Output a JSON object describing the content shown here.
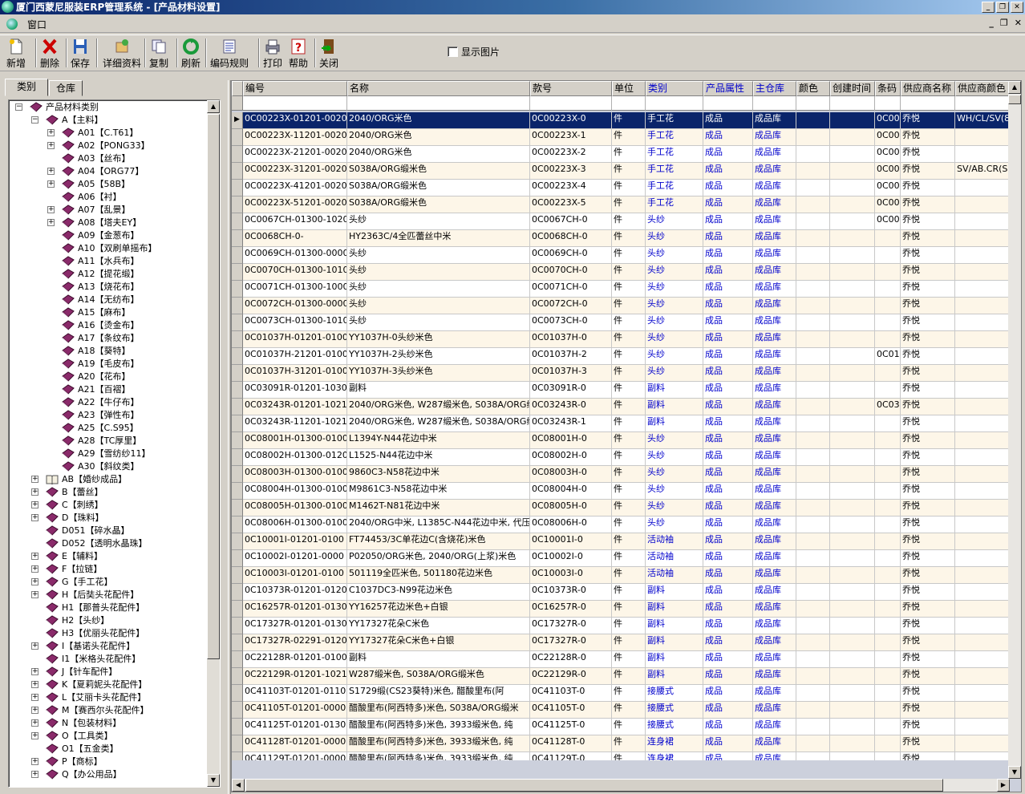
{
  "window": {
    "title": "厦门西蒙尼服装ERP管理系统 - [产品材料设置]"
  },
  "menu": {
    "window_label": "窗口"
  },
  "toolbar": {
    "buttons": [
      {
        "label": "新增",
        "icon": "new-document-icon"
      },
      {
        "label": "删除",
        "icon": "delete-x-icon"
      },
      {
        "label": "保存",
        "icon": "save-disk-icon"
      },
      {
        "label": "详细资料",
        "icon": "details-icon"
      },
      {
        "label": "复制",
        "icon": "copy-icon"
      },
      {
        "label": "刷新",
        "icon": "refresh-icon"
      },
      {
        "label": "编码规则",
        "icon": "code-rule-icon"
      },
      {
        "label": "打印",
        "icon": "print-icon"
      },
      {
        "label": "帮助",
        "icon": "help-icon"
      },
      {
        "label": "关闭",
        "icon": "close-door-icon"
      }
    ],
    "show_picture_label": "显示图片",
    "show_picture_checked": false
  },
  "left_tabs": [
    "类别",
    "仓库"
  ],
  "tree": [
    {
      "level": 0,
      "expander": "-",
      "label": "产品材料类别"
    },
    {
      "level": 1,
      "expander": "-",
      "label": "A【主料】"
    },
    {
      "level": 2,
      "expander": "+",
      "label": "A01【C.T61】"
    },
    {
      "level": 2,
      "expander": "+",
      "label": "A02【PONG33】"
    },
    {
      "level": 2,
      "expander": "",
      "label": "A03【丝布】"
    },
    {
      "level": 2,
      "expander": "+",
      "label": "A04【ORG77】"
    },
    {
      "level": 2,
      "expander": "+",
      "label": "A05【58B】"
    },
    {
      "level": 2,
      "expander": "",
      "label": "A06【衬】"
    },
    {
      "level": 2,
      "expander": "+",
      "label": "A07【乱景】"
    },
    {
      "level": 2,
      "expander": "+",
      "label": "A08【塔夫EY】"
    },
    {
      "level": 2,
      "expander": "",
      "label": "A09【金葱布】"
    },
    {
      "level": 2,
      "expander": "",
      "label": "A10【双刷单摇布】"
    },
    {
      "level": 2,
      "expander": "",
      "label": "A11【水兵布】"
    },
    {
      "level": 2,
      "expander": "",
      "label": "A12【提花缎】"
    },
    {
      "level": 2,
      "expander": "",
      "label": "A13【烧花布】"
    },
    {
      "level": 2,
      "expander": "",
      "label": "A14【无纺布】"
    },
    {
      "level": 2,
      "expander": "",
      "label": "A15【麻布】"
    },
    {
      "level": 2,
      "expander": "",
      "label": "A16【烫金布】"
    },
    {
      "level": 2,
      "expander": "",
      "label": "A17【条纹布】"
    },
    {
      "level": 2,
      "expander": "",
      "label": "A18【葵特】"
    },
    {
      "level": 2,
      "expander": "",
      "label": "A19【毛皮布】"
    },
    {
      "level": 2,
      "expander": "",
      "label": "A20【花布】"
    },
    {
      "level": 2,
      "expander": "",
      "label": "A21【百褶】"
    },
    {
      "level": 2,
      "expander": "",
      "label": "A22【牛仔布】"
    },
    {
      "level": 2,
      "expander": "",
      "label": "A23【弹性布】"
    },
    {
      "level": 2,
      "expander": "",
      "label": "A25【C.S95】"
    },
    {
      "level": 2,
      "expander": "",
      "label": "A28【TC厚里】"
    },
    {
      "level": 2,
      "expander": "",
      "label": "A29【雪纺纱11】"
    },
    {
      "level": 2,
      "expander": "",
      "label": "A30【斜纹类】"
    },
    {
      "level": 1,
      "expander": "+",
      "label": "AB【婚纱成品】",
      "book": "open"
    },
    {
      "level": 1,
      "expander": "+",
      "label": "B【蕾丝】"
    },
    {
      "level": 1,
      "expander": "+",
      "label": "C【刺绣】"
    },
    {
      "level": 1,
      "expander": "+",
      "label": "D【珠料】"
    },
    {
      "level": 1,
      "expander": "",
      "label": "D051【碎水晶】"
    },
    {
      "level": 1,
      "expander": "",
      "label": "D052【透明水晶珠】"
    },
    {
      "level": 1,
      "expander": "+",
      "label": "E【辅料】"
    },
    {
      "level": 1,
      "expander": "+",
      "label": "F【拉链】"
    },
    {
      "level": 1,
      "expander": "+",
      "label": "G【手工花】"
    },
    {
      "level": 1,
      "expander": "+",
      "label": "H【后奘头花配件】"
    },
    {
      "level": 1,
      "expander": "",
      "label": "H1【那普头花配件】"
    },
    {
      "level": 1,
      "expander": "",
      "label": "H2【头纱】"
    },
    {
      "level": 1,
      "expander": "",
      "label": "H3【优丽头花配件】"
    },
    {
      "level": 1,
      "expander": "+",
      "label": "I【基诺头花配件】"
    },
    {
      "level": 1,
      "expander": "",
      "label": "I1【米格头花配件】"
    },
    {
      "level": 1,
      "expander": "+",
      "label": "J【针车配件】"
    },
    {
      "level": 1,
      "expander": "+",
      "label": "K【夏莉妮头花配件】"
    },
    {
      "level": 1,
      "expander": "+",
      "label": "L【艾丽卡头花配件】"
    },
    {
      "level": 1,
      "expander": "+",
      "label": "M【赛西尔头花配件】"
    },
    {
      "level": 1,
      "expander": "+",
      "label": "N【包装材料】"
    },
    {
      "level": 1,
      "expander": "+",
      "label": "O【工具类】"
    },
    {
      "level": 1,
      "expander": "",
      "label": "O1【五金类】"
    },
    {
      "level": 1,
      "expander": "+",
      "label": "P【商标】"
    },
    {
      "level": 1,
      "expander": "+",
      "label": "Q【办公用品】"
    }
  ],
  "grid": {
    "columns": [
      {
        "label": "编号",
        "blue": false
      },
      {
        "label": "名称",
        "blue": false
      },
      {
        "label": "款号",
        "blue": false
      },
      {
        "label": "单位",
        "blue": false
      },
      {
        "label": "类别",
        "blue": true
      },
      {
        "label": "产品属性",
        "blue": true
      },
      {
        "label": "主仓库",
        "blue": true
      },
      {
        "label": "颜色",
        "blue": false
      },
      {
        "label": "创建时间",
        "blue": false
      },
      {
        "label": "条码",
        "blue": false
      },
      {
        "label": "供应商名称",
        "blue": false
      },
      {
        "label": "供应商颜色",
        "blue": false
      }
    ],
    "selected_row": 0,
    "rows": [
      [
        "0C00223X-01201-0020",
        "2040/ORG米色",
        "0C00223X-0",
        "件",
        "手工花",
        "成品",
        "成品库",
        "",
        "",
        "0C00",
        "乔悦",
        "WH/CL/SV(8"
      ],
      [
        "0C00223X-11201-0020",
        "2040/ORG米色",
        "0C00223X-1",
        "件",
        "手工花",
        "成品",
        "成品库",
        "",
        "",
        "0C00",
        "乔悦",
        ""
      ],
      [
        "0C00223X-21201-0020",
        "2040/ORG米色",
        "0C00223X-2",
        "件",
        "手工花",
        "成品",
        "成品库",
        "",
        "",
        "0C00",
        "乔悦",
        ""
      ],
      [
        "0C00223X-31201-0020",
        "S038A/ORG缎米色",
        "0C00223X-3",
        "件",
        "手工花",
        "成品",
        "成品库",
        "",
        "",
        "0C00",
        "乔悦",
        "SV/AB.CR(S"
      ],
      [
        "0C00223X-41201-0020",
        "S038A/ORG缎米色",
        "0C00223X-4",
        "件",
        "手工花",
        "成品",
        "成品库",
        "",
        "",
        "0C00",
        "乔悦",
        ""
      ],
      [
        "0C00223X-51201-0020",
        "S038A/ORG缎米色",
        "0C00223X-5",
        "件",
        "手工花",
        "成品",
        "成品库",
        "",
        "",
        "0C00",
        "乔悦",
        ""
      ],
      [
        "0C0067CH-01300-1020",
        "头纱",
        "0C0067CH-0",
        "件",
        "头纱",
        "成品",
        "成品库",
        "",
        "",
        "0C00",
        "乔悦",
        ""
      ],
      [
        "0C0068CH-0-",
        "HY2363C/4全匹蕾丝中米",
        "0C0068CH-0",
        "件",
        "头纱",
        "成品",
        "成品库",
        "",
        "",
        "",
        "乔悦",
        ""
      ],
      [
        "0C0069CH-01300-0000",
        "头纱",
        "0C0069CH-0",
        "件",
        "头纱",
        "成品",
        "成品库",
        "",
        "",
        "",
        "乔悦",
        ""
      ],
      [
        "0C0070CH-01300-1010",
        "头纱",
        "0C0070CH-0",
        "件",
        "头纱",
        "成品",
        "成品库",
        "",
        "",
        "",
        "乔悦",
        ""
      ],
      [
        "0C0071CH-01300-1000",
        "头纱",
        "0C0071CH-0",
        "件",
        "头纱",
        "成品",
        "成品库",
        "",
        "",
        "",
        "乔悦",
        ""
      ],
      [
        "0C0072CH-01300-0000",
        "头纱",
        "0C0072CH-0",
        "件",
        "头纱",
        "成品",
        "成品库",
        "",
        "",
        "",
        "乔悦",
        ""
      ],
      [
        "0C0073CH-01300-1010",
        "头纱",
        "0C0073CH-0",
        "件",
        "头纱",
        "成品",
        "成品库",
        "",
        "",
        "",
        "乔悦",
        ""
      ],
      [
        "0C01037H-01201-0100",
        "YY1037H-0头纱米色",
        "0C01037H-0",
        "件",
        "头纱",
        "成品",
        "成品库",
        "",
        "",
        "",
        "乔悦",
        ""
      ],
      [
        "0C01037H-21201-0100",
        "YY1037H-2头纱米色",
        "0C01037H-2",
        "件",
        "头纱",
        "成品",
        "成品库",
        "",
        "",
        "0C01",
        "乔悦",
        ""
      ],
      [
        "0C01037H-31201-0100",
        "YY1037H-3头纱米色",
        "0C01037H-3",
        "件",
        "头纱",
        "成品",
        "成品库",
        "",
        "",
        "",
        "乔悦",
        ""
      ],
      [
        "0C03091R-01201-1030",
        "副料",
        "0C03091R-0",
        "件",
        "副料",
        "成品",
        "成品库",
        "",
        "",
        "",
        "乔悦",
        ""
      ],
      [
        "0C03243R-01201-1021",
        "2040/ORG米色, W287缎米色, S038A/ORG缎",
        "0C03243R-0",
        "件",
        "副料",
        "成品",
        "成品库",
        "",
        "",
        "0C03",
        "乔悦",
        ""
      ],
      [
        "0C03243R-11201-1021",
        "2040/ORG米色, W287缎米色, S038A/ORG缎",
        "0C03243R-1",
        "件",
        "副料",
        "成品",
        "成品库",
        "",
        "",
        "",
        "乔悦",
        ""
      ],
      [
        "0C08001H-01300-0100",
        "L1394Y-N44花边中米",
        "0C08001H-0",
        "件",
        "头纱",
        "成品",
        "成品库",
        "",
        "",
        "",
        "乔悦",
        ""
      ],
      [
        "0C08002H-01300-0120",
        "L1525-N44花边中米",
        "0C08002H-0",
        "件",
        "头纱",
        "成品",
        "成品库",
        "",
        "",
        "",
        "乔悦",
        ""
      ],
      [
        "0C08003H-01300-0100",
        "9860C3-N58花边中米",
        "0C08003H-0",
        "件",
        "头纱",
        "成品",
        "成品库",
        "",
        "",
        "",
        "乔悦",
        ""
      ],
      [
        "0C08004H-01300-0100",
        "M9861C3-N58花边中米",
        "0C08004H-0",
        "件",
        "头纱",
        "成品",
        "成品库",
        "",
        "",
        "",
        "乔悦",
        ""
      ],
      [
        "0C08005H-01300-0100",
        "M1462T-N81花边中米",
        "0C08005H-0",
        "件",
        "头纱",
        "成品",
        "成品库",
        "",
        "",
        "",
        "乔悦",
        ""
      ],
      [
        "0C08006H-01300-0100",
        "2040/ORG中米, L1385C-N44花边中米, 代压",
        "0C08006H-0",
        "件",
        "头纱",
        "成品",
        "成品库",
        "",
        "",
        "",
        "乔悦",
        ""
      ],
      [
        "0C10001I-01201-0100",
        "FT74453/3C单花边C(含烧花)米色",
        "0C10001I-0",
        "件",
        "活动袖",
        "成品",
        "成品库",
        "",
        "",
        "",
        "乔悦",
        ""
      ],
      [
        "0C10002I-01201-0000",
        "P02050/ORG米色, 2040/ORG(上浆)米色",
        "0C10002I-0",
        "件",
        "活动袖",
        "成品",
        "成品库",
        "",
        "",
        "",
        "乔悦",
        ""
      ],
      [
        "0C10003I-01201-0100",
        "501119全匹米色, 501180花边米色",
        "0C10003I-0",
        "件",
        "活动袖",
        "成品",
        "成品库",
        "",
        "",
        "",
        "乔悦",
        ""
      ],
      [
        "0C10373R-01201-0120",
        "C1037DC3-N99花边米色",
        "0C10373R-0",
        "件",
        "副料",
        "成品",
        "成品库",
        "",
        "",
        "",
        "乔悦",
        ""
      ],
      [
        "0C16257R-01201-0130",
        "YY16257花边米色+白银",
        "0C16257R-0",
        "件",
        "副料",
        "成品",
        "成品库",
        "",
        "",
        "",
        "乔悦",
        ""
      ],
      [
        "0C17327R-01201-0130",
        "YY17327花朵C米色",
        "0C17327R-0",
        "件",
        "副料",
        "成品",
        "成品库",
        "",
        "",
        "",
        "乔悦",
        ""
      ],
      [
        "0C17327R-02291-0120",
        "YY17327花朵C米色+白银",
        "0C17327R-0",
        "件",
        "副料",
        "成品",
        "成品库",
        "",
        "",
        "",
        "乔悦",
        ""
      ],
      [
        "0C22128R-01201-0100",
        "副料",
        "0C22128R-0",
        "件",
        "副料",
        "成品",
        "成品库",
        "",
        "",
        "",
        "乔悦",
        ""
      ],
      [
        "0C22129R-01201-1021",
        "W287缎米色, S038A/ORG缎米色",
        "0C22129R-0",
        "件",
        "副料",
        "成品",
        "成品库",
        "",
        "",
        "",
        "乔悦",
        ""
      ],
      [
        "0C41103T-01201-0110",
        "S1729缎(CS23葵特)米色, 醋酸里布(阿",
        "0C41103T-0",
        "件",
        "接腰式",
        "成品",
        "成品库",
        "",
        "",
        "",
        "乔悦",
        ""
      ],
      [
        "0C41105T-01201-0000",
        "醋酸里布(阿西特多)米色, S038A/ORG缎米",
        "0C41105T-0",
        "件",
        "接腰式",
        "成品",
        "成品库",
        "",
        "",
        "",
        "乔悦",
        ""
      ],
      [
        "0C41125T-01201-0130",
        "醋酸里布(阿西特多)米色, 3933缎米色, 纯",
        "0C41125T-0",
        "件",
        "接腰式",
        "成品",
        "成品库",
        "",
        "",
        "",
        "乔悦",
        ""
      ],
      [
        "0C41128T-01201-0000",
        "醋酸里布(阿西特多)米色, 3933缎米色, 纯",
        "0C41128T-0",
        "件",
        "连身裙",
        "成品",
        "成品库",
        "",
        "",
        "",
        "乔悦",
        ""
      ],
      [
        "0C41129T-01201-0000",
        "醋酸里布(阿西特多)米色, 3933缎米色, 纯",
        "0C41129T-0",
        "件",
        "连身裙",
        "成品",
        "成品库",
        "",
        "",
        "",
        "乔悦",
        ""
      ]
    ]
  }
}
